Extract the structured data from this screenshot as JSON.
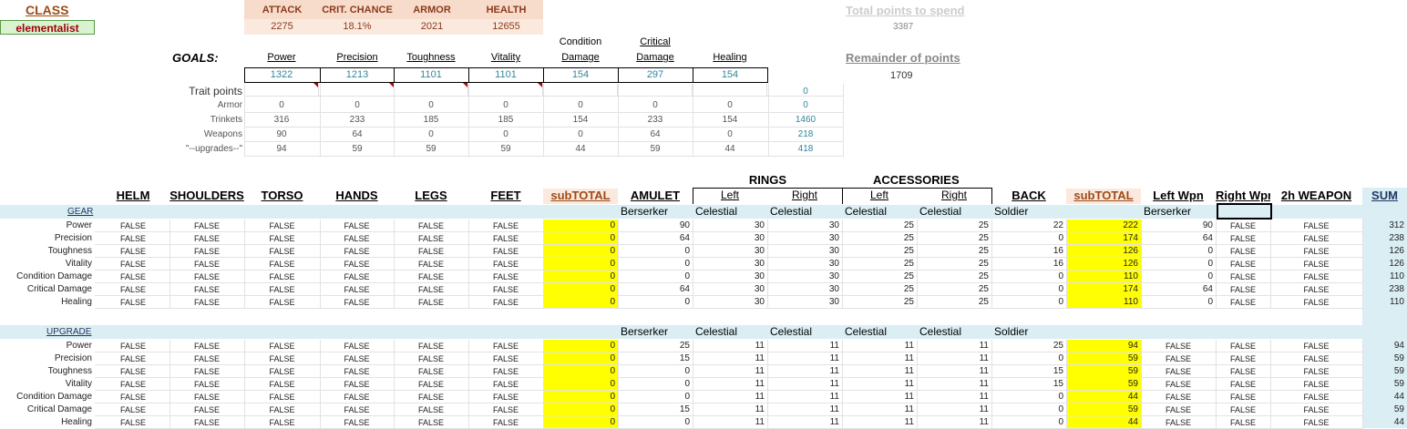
{
  "class_label": "CLASS",
  "class_value": "elementalist",
  "stats": {
    "headers": [
      "ATTACK",
      "CRIT. CHANCE",
      "ARMOR",
      "HEALTH"
    ],
    "values": [
      "2275",
      "18.1%",
      "2021",
      "12655"
    ]
  },
  "total_points": {
    "label": "Total points to spend",
    "value": "3387"
  },
  "remainder": {
    "label": "Remainder of points",
    "value": "1709"
  },
  "goals": {
    "label": "GOALS:",
    "attributes": [
      "Power",
      "Precision",
      "Toughness",
      "Vitality",
      "Condition Damage",
      "Critical Damage",
      "Healing"
    ],
    "condition_line1": "Condition",
    "condition_line2": "Damage",
    "critical_line1": "Critical",
    "critical_line2": "Damage",
    "values": [
      "1322",
      "1213",
      "1101",
      "1101",
      "154",
      "297",
      "154"
    ]
  },
  "summary_rows": [
    {
      "label": "Trait points",
      "values": [
        "",
        "",
        "",
        "",
        "",
        "",
        ""
      ],
      "total": "0"
    },
    {
      "label": "Armor",
      "values": [
        "0",
        "0",
        "0",
        "0",
        "0",
        "0",
        "0"
      ],
      "total": "0"
    },
    {
      "label": "Trinkets",
      "values": [
        "316",
        "233",
        "185",
        "185",
        "154",
        "233",
        "154"
      ],
      "total": "1460"
    },
    {
      "label": "Weapons",
      "values": [
        "90",
        "64",
        "0",
        "0",
        "0",
        "64",
        "0"
      ],
      "total": "218"
    },
    {
      "label": "\"--upgrades--\"",
      "values": [
        "94",
        "59",
        "59",
        "59",
        "44",
        "59",
        "44"
      ],
      "total": "418"
    }
  ],
  "groups": {
    "rings": "RINGS",
    "accessories": "ACCESSORIES"
  },
  "columns": [
    "HELM",
    "SHOULDERS",
    "TORSO",
    "HANDS",
    "LEGS",
    "FEET",
    "subTOTAL",
    "AMULET",
    "Left",
    "Right",
    "Left",
    "Right",
    "BACK",
    "subTOTAL",
    "Left Wpn",
    "Right Wpn",
    "2h WEAPON",
    "SUM"
  ],
  "attr_rows": [
    "Power",
    "Precision",
    "Toughness",
    "Vitality",
    "Condition Damage",
    "Critical Damage",
    "Healing"
  ],
  "gear": {
    "label": "GEAR",
    "set_names": [
      "Berserker",
      "Celestial",
      "Celestial",
      "Celestial",
      "Celestial",
      "Soldier",
      "Berserker"
    ],
    "armor_value": "FALSE",
    "subtotal1": [
      "0",
      "0",
      "0",
      "0",
      "0",
      "0",
      "0"
    ],
    "amulet": [
      "90",
      "64",
      "0",
      "0",
      "0",
      "64",
      "0"
    ],
    "ring_left": [
      "30",
      "30",
      "30",
      "30",
      "30",
      "30",
      "30"
    ],
    "ring_right": [
      "30",
      "30",
      "30",
      "30",
      "30",
      "30",
      "30"
    ],
    "acc_left": [
      "25",
      "25",
      "25",
      "25",
      "25",
      "25",
      "25"
    ],
    "acc_right": [
      "25",
      "25",
      "25",
      "25",
      "25",
      "25",
      "25"
    ],
    "back": [
      "22",
      "0",
      "16",
      "16",
      "0",
      "0",
      "0"
    ],
    "subtotal2": [
      "222",
      "174",
      "126",
      "126",
      "110",
      "174",
      "110"
    ],
    "left_wpn": [
      "90",
      "64",
      "0",
      "0",
      "0",
      "64",
      "0"
    ],
    "right_wpn": [
      "FALSE",
      "FALSE",
      "FALSE",
      "FALSE",
      "FALSE",
      "FALSE",
      "FALSE"
    ],
    "two_h": [
      "FALSE",
      "FALSE",
      "FALSE",
      "FALSE",
      "FALSE",
      "FALSE",
      "FALSE"
    ],
    "sum": [
      "312",
      "238",
      "126",
      "126",
      "110",
      "238",
      "110"
    ]
  },
  "upgrade": {
    "label": "UPGRADE",
    "set_names": [
      "Berserker",
      "Celestial",
      "Celestial",
      "Celestial",
      "Celestial",
      "Soldier"
    ],
    "armor_value": "FALSE",
    "subtotal1": [
      "0",
      "0",
      "0",
      "0",
      "0",
      "0",
      "0"
    ],
    "amulet": [
      "25",
      "15",
      "0",
      "0",
      "0",
      "15",
      "0"
    ],
    "ring_left": [
      "11",
      "11",
      "11",
      "11",
      "11",
      "11",
      "11"
    ],
    "ring_right": [
      "11",
      "11",
      "11",
      "11",
      "11",
      "11",
      "11"
    ],
    "acc_left": [
      "11",
      "11",
      "11",
      "11",
      "11",
      "11",
      "11"
    ],
    "acc_right": [
      "11",
      "11",
      "11",
      "11",
      "11",
      "11",
      "11"
    ],
    "back": [
      "25",
      "0",
      "15",
      "15",
      "0",
      "0",
      "0"
    ],
    "subtotal2": [
      "94",
      "59",
      "59",
      "59",
      "44",
      "59",
      "44"
    ],
    "left_wpn": [
      "FALSE",
      "FALSE",
      "FALSE",
      "FALSE",
      "FALSE",
      "FALSE",
      "FALSE"
    ],
    "right_wpn": [
      "FALSE",
      "FALSE",
      "FALSE",
      "FALSE",
      "FALSE",
      "FALSE",
      "FALSE"
    ],
    "two_h": [
      "FALSE",
      "FALSE",
      "FALSE",
      "FALSE",
      "FALSE",
      "FALSE",
      "FALSE"
    ],
    "sum": [
      "94",
      "59",
      "59",
      "59",
      "44",
      "59",
      "44"
    ]
  },
  "colors": {
    "highlight": "#ffff00",
    "band": "#daeef3",
    "stat_header": "#f7dccc",
    "accent": "#9c4a16",
    "teal": "#31869b"
  }
}
